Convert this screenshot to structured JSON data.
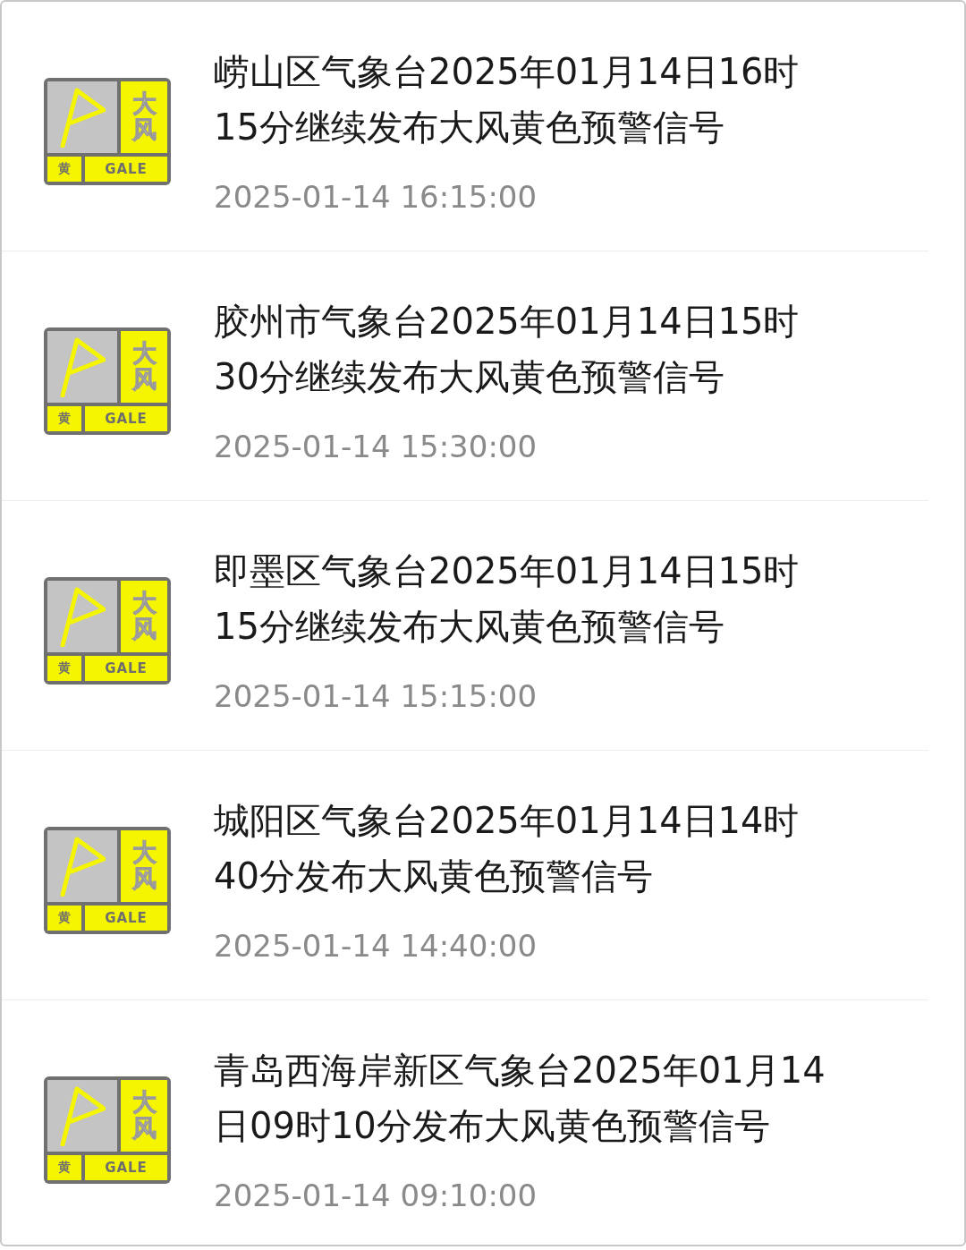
{
  "alerts": [
    {
      "sign": {
        "name": "大风",
        "level": "黄",
        "code": "GALE"
      },
      "title_lines": [
        "崂山区气象台2025年01月14日16时",
        "15分继续发布大风黄色预警信号"
      ],
      "time": "2025-01-14 16:15:00"
    },
    {
      "sign": {
        "name": "大风",
        "level": "黄",
        "code": "GALE"
      },
      "title_lines": [
        "胶州市气象台2025年01月14日15时",
        "30分继续发布大风黄色预警信号"
      ],
      "time": "2025-01-14 15:30:00"
    },
    {
      "sign": {
        "name": "大风",
        "level": "黄",
        "code": "GALE"
      },
      "title_lines": [
        "即墨区气象台2025年01月14日15时",
        "15分继续发布大风黄色预警信号"
      ],
      "time": "2025-01-14 15:15:00"
    },
    {
      "sign": {
        "name": "大风",
        "level": "黄",
        "code": "GALE"
      },
      "title_lines": [
        "城阳区气象台2025年01月14日14时",
        "40分发布大风黄色预警信号"
      ],
      "time": "2025-01-14 14:40:00"
    },
    {
      "sign": {
        "name": "大风",
        "level": "黄",
        "code": "GALE"
      },
      "title_lines": [
        "青岛西海岸新区气象台2025年01月14",
        "日09时10分发布大风黄色预警信号"
      ],
      "time": "2025-01-14 09:10:00"
    }
  ]
}
